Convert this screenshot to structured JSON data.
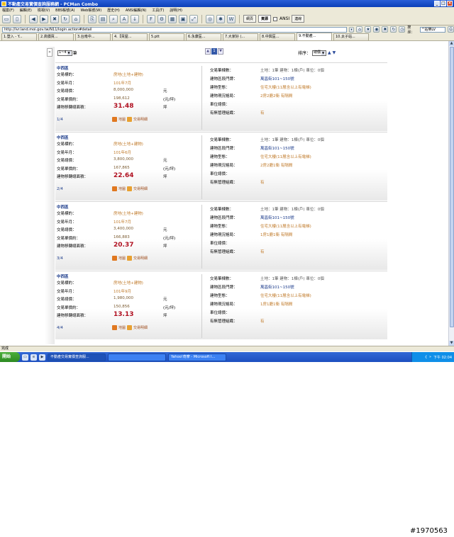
{
  "window": {
    "title": "不動產交易實價查詢服務網 - PCMan Combo",
    "controls": [
      "_",
      "□",
      "×"
    ]
  },
  "menu": [
    "檔案(F)",
    "編輯(E)",
    "檢視(V)",
    "BBS帳號(A)",
    "Web帳號(W)",
    "歷史(H)",
    "ANSI編輯(N)",
    "工具(T)",
    "說明(H)"
  ],
  "toolbar": {
    "bbs_label": "網頁",
    "web_label": "資源",
    "ansi_label": "ANSI",
    "extra_label": "連線"
  },
  "address": {
    "url": "http://lvr.land.moi.gov.tw/N11/login.action#detail",
    "search_label": "搜尋：",
    "search_value": "^站樂LV"
  },
  "tabs": [
    {
      "label": "1.登入 - Y...",
      "active": false
    },
    {
      "label": "2.高價買...",
      "active": false
    },
    {
      "label": "3.台南中...",
      "active": false
    },
    {
      "label": "4.【買屋...",
      "active": false
    },
    {
      "label": "5.ptt",
      "active": false
    },
    {
      "label": "6.永康區...",
      "active": false
    },
    {
      "label": "7.大家好 (...",
      "active": false
    },
    {
      "label": "8.中興區...",
      "active": false
    },
    {
      "label": "9.不動產...",
      "active": true
    },
    {
      "label": "10.太子站...",
      "active": false
    }
  ],
  "pager": {
    "per_page": "1~4",
    "per_page_suffix": "筆",
    "pages": [
      "▲",
      "1",
      "▼"
    ],
    "sort_label": "排序：",
    "sort_value": "總價"
  },
  "records": [
    {
      "district": "中西區",
      "type": "房地(土地+建物)",
      "date": "101年7月",
      "total_price": "8,000,000",
      "total_unit": "元",
      "unit_price": "198,612",
      "unit_price_unit": "(元/坪)",
      "area": "31.48",
      "area_unit": "坪",
      "index": "1/4",
      "land": "1筆",
      "building": "1棟(戶)",
      "parking": "0個",
      "address": "萬昌街101~150號",
      "building_type": "住宅大樓(11層含以上有電梯)",
      "layout": "2房2廳2衛 有隔間",
      "parking_price": "",
      "management": "有"
    },
    {
      "district": "中西區",
      "type": "房地(土地+建物)",
      "date": "101年6月",
      "total_price": "3,800,000",
      "total_unit": "元",
      "unit_price": "167,865",
      "unit_price_unit": "(元/坪)",
      "area": "22.64",
      "area_unit": "坪",
      "index": "2/4",
      "land": "1筆",
      "building": "1棟(戶)",
      "parking": "0個",
      "address": "萬昌街101~150號",
      "building_type": "住宅大樓(11層含以上有電梯)",
      "layout": "2房2廳1衛 有隔間",
      "parking_price": "",
      "management": "有"
    },
    {
      "district": "中西區",
      "type": "房地(土地+建物)",
      "date": "101年7月",
      "total_price": "3,400,000",
      "total_unit": "元",
      "unit_price": "166,883",
      "unit_price_unit": "(元/坪)",
      "area": "20.37",
      "area_unit": "坪",
      "index": "3/4",
      "land": "1筆",
      "building": "1棟(戶)",
      "parking": "0個",
      "address": "萬昌街101~150號",
      "building_type": "住宅大樓(11層含以上有電梯)",
      "layout": "1房1廳1衛 有隔間",
      "parking_price": "",
      "management": "有"
    },
    {
      "district": "中西區",
      "type": "房地(土地+建物)",
      "date": "101年9月",
      "total_price": "1,980,000",
      "total_unit": "元",
      "unit_price": "150,856",
      "unit_price_unit": "(元/坪)",
      "area": "13.13",
      "area_unit": "坪",
      "index": "4/4",
      "land": "1筆",
      "building": "1棟(戶)",
      "parking": "0個",
      "address": "萬昌街101~150號",
      "building_type": "住宅大樓(11層含以上有電梯)",
      "layout": "1房1廳1衛 有隔間",
      "parking_price": "",
      "management": "有"
    }
  ],
  "labels": {
    "type": "交易標的：",
    "date": "交易年月：",
    "total": "交易總價：",
    "unit": "交易單價約：",
    "area": "建物移轉總面積：",
    "map": "地圖",
    "detail": "交易明細",
    "count": "交易筆棟數：",
    "address": "建物區段門牌：",
    "btype": "建物型態：",
    "layout": "建物現況格局：",
    "parking": "車位總價：",
    "mgmt": "有無管理組織：",
    "land": "土地：",
    "building": "建物：",
    "parking_count": "車位："
  },
  "status": {
    "text": "完成"
  },
  "taskbar": {
    "start": "開始",
    "tasks": [
      {
        "label": "不動產交易實價查詢服...",
        "active": true
      },
      {
        "label": "",
        "active": false
      },
      {
        "label": "Yahoo!奇摩 - Microsoft I...",
        "active": false
      }
    ],
    "time": "下午 02:04",
    "tray_icons": [
      "《",
      "»"
    ]
  },
  "watermark": "#1970563"
}
